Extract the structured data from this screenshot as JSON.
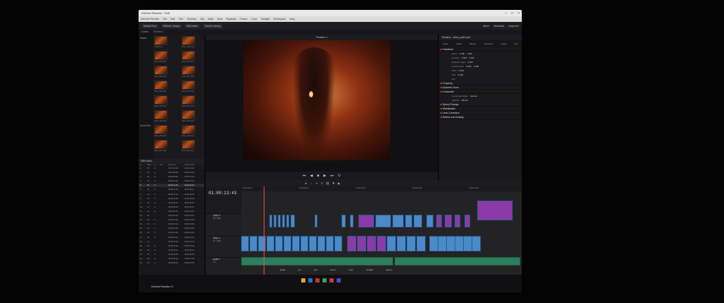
{
  "window": {
    "title": "DaVinci Resolve - Edit",
    "app_label": "DaVinci Resolve 17"
  },
  "menu": [
    "DaVinci Resolve",
    "File",
    "Edit",
    "Trim",
    "Timeline",
    "Clip",
    "Mark",
    "View",
    "Playback",
    "Fusion",
    "Color",
    "Fairlight",
    "Workspace",
    "Help"
  ],
  "toolbar": {
    "items": [
      "Media Pool",
      "Effects Library",
      "Edit Index",
      "Sound Library"
    ],
    "right": [
      "Mixer",
      "Metadata",
      "Inspector"
    ]
  },
  "subbar": [
    "Master",
    "Timeline 1"
  ],
  "viewer": {
    "title": "Untitled",
    "timeline_name": "Timeline 1",
    "timecode": "01:00:13:43"
  },
  "media_pool": {
    "sidebar": [
      "Master",
      "Smart Bins"
    ],
    "clips": [
      "Timeline 1",
      "drink_pot0.mp4",
      "drink_003.mp4",
      "drink_004.mp4",
      "drink_006.mp4",
      "drink_007.mp4",
      "drink_009.mp4",
      "drink_010.mp4",
      "drink_012.mp4",
      "drink_013.mp4",
      "drink_015.mp4",
      "drink_016.mp4",
      "drink_018.mp4",
      "drink_019.mp4",
      "drink_021.mp4",
      "drink_022.mp4"
    ]
  },
  "edit_index": {
    "title": "Edit Index",
    "columns": [
      "#",
      "Reel",
      "V",
      "Dur",
      "Source In",
      "Source Out"
    ],
    "rows": [
      [
        "1",
        "V2",
        "C",
        "",
        "00:01:10:00",
        "00:01:12:14"
      ],
      [
        "2",
        "V2",
        "C",
        "",
        "00:00:08:08",
        "00:00:10:03"
      ],
      [
        "3",
        "V2",
        "C",
        "",
        "00:00:08:08",
        "00:00:10:03"
      ],
      [
        "4",
        "V2",
        "C",
        "",
        "00:00:14:13",
        "00:00:16:10"
      ],
      [
        "5",
        "V2",
        "C",
        "",
        "00:00:21:00",
        "00:00:23:04"
      ],
      [
        "6",
        "V2",
        "C",
        "",
        "00:00:07:08",
        "00:00:09:17"
      ],
      [
        "7",
        "V2",
        "C",
        "",
        "00:00:17:20",
        "00:00:19:05"
      ],
      [
        "8",
        "V2",
        "C",
        "",
        "00:00:46:06",
        "00:00:48:09"
      ],
      [
        "9",
        "V2",
        "C",
        "",
        "00:00:03:16",
        "00:00:05:07"
      ],
      [
        "10",
        "V2",
        "C",
        "",
        "00:00:08:06",
        "00:00:10:01"
      ],
      [
        "11",
        "V2",
        "C",
        "",
        "00:00:20:07",
        "00:00:22:14"
      ],
      [
        "12",
        "A1",
        "",
        "",
        "00:00:09:23",
        "00:00:11:07"
      ],
      [
        "13",
        "V2",
        "C",
        "",
        "00:00:14:10",
        "00:00:16:04"
      ],
      [
        "14",
        "V2",
        "C",
        "",
        "00:00:02:14",
        "00:00:04:09"
      ],
      [
        "15",
        "V2",
        "C",
        "",
        "00:00:01:05",
        "00:00:03:01"
      ],
      [
        "16",
        "V2",
        "C",
        "",
        "00:00:12:02",
        "00:00:14:16"
      ],
      [
        "17",
        "V2",
        "C",
        "",
        "00:00:05:13",
        "00:00:07:12"
      ],
      [
        "18",
        "A1",
        "",
        "",
        "00:00:10:20",
        "00:00:12:15"
      ],
      [
        "19",
        "V2",
        "C",
        "",
        "00:00:26:00",
        "00:00:28:09"
      ],
      [
        "20",
        "V2",
        "C",
        "",
        "00:00:18:11",
        "00:00:20:13"
      ],
      [
        "21",
        "V2",
        "C",
        "",
        "00:00:03:08",
        "00:00:05:00"
      ],
      [
        "22",
        "V2",
        "C",
        "",
        "00:00:15:16",
        "00:00:17:02"
      ],
      [
        "23",
        "V2",
        "C",
        "",
        "00:00:08:12",
        "00:00:10:05"
      ]
    ]
  },
  "inspector": {
    "title": "Timeline - drink_pot0.mp4",
    "tabs": [
      "Video",
      "Audio",
      "Effects",
      "Transition",
      "Image",
      "File"
    ],
    "sections": [
      "Transform",
      "Cropping",
      "Dynamic Zoom",
      "Composite",
      "Speed Change",
      "Stabilization",
      "Lens Correction",
      "Retime and Scaling"
    ],
    "transform_rows": [
      {
        "label": "Zoom",
        "x": "1.000",
        "y": "1.000"
      },
      {
        "label": "Position",
        "x": "0.000",
        "y": "0.000"
      },
      {
        "label": "Rotation Angle",
        "x": "0.000",
        "y": ""
      },
      {
        "label": "Anchor Point",
        "x": "0.000",
        "y": "0.000"
      },
      {
        "label": "Pitch",
        "x": "0.000",
        "y": ""
      },
      {
        "label": "Yaw",
        "x": "0.000",
        "y": ""
      },
      {
        "label": "Flip",
        "x": "",
        "y": ""
      }
    ],
    "composite_rows": [
      {
        "label": "Composite Mode",
        "value": "Normal"
      },
      {
        "label": "Opacity",
        "value": "100.00"
      }
    ]
  },
  "timeline": {
    "tracks": [
      {
        "name": "Video 2",
        "clips": "22 Clips"
      },
      {
        "name": "Video 1",
        "clips": "31 Clips"
      },
      {
        "name": "Audio 1",
        "clips": "2.0"
      }
    ],
    "ruler": [
      "01:00:00:00",
      "01:00:08:00",
      "01:00:16:00",
      "01:00:24:00",
      "01:00:32:00",
      "01:00:40:00"
    ]
  },
  "pages": [
    "Media",
    "Cut",
    "Edit",
    "Fusion",
    "Color",
    "Fairlight",
    "Deliver"
  ]
}
